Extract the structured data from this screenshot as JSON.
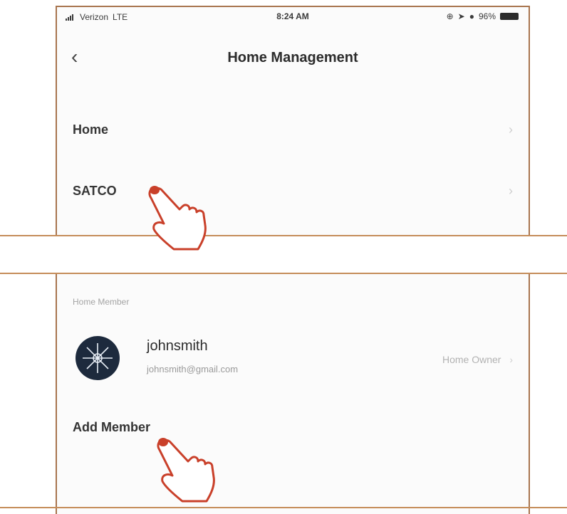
{
  "status_bar": {
    "carrier": "Verizon",
    "network": "LTE",
    "time": "8:24 AM",
    "battery": "96%"
  },
  "nav": {
    "back_icon": "chevron-left",
    "title": "Home Management"
  },
  "homes": [
    {
      "label": "Home"
    },
    {
      "label": "SATCO"
    }
  ],
  "members_section": {
    "label": "Home Member",
    "member": {
      "name": "johnsmith",
      "email": "johnsmith@gmail.com",
      "role": "Home Owner"
    },
    "add_label": "Add Member"
  },
  "icons": {
    "row_chevron": "chevron-right",
    "pointer": "pointing-hand"
  },
  "colors": {
    "border": "#a8754f",
    "divider": "#c58d5a",
    "hand_outline": "#c9402a"
  }
}
